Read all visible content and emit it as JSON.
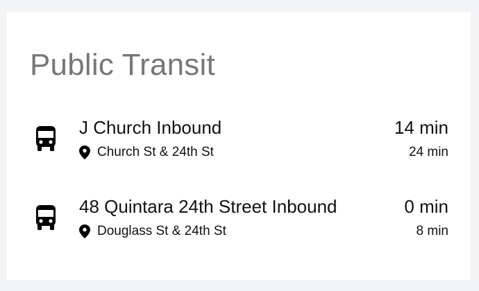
{
  "card": {
    "title": "Public Transit"
  },
  "departures": [
    {
      "icon": "bus-icon",
      "line": "J Church Inbound",
      "stop_icon": "map-pin-icon",
      "stop": "Church St & 24th St",
      "eta": "14 min",
      "next": "24 min"
    },
    {
      "icon": "bus-icon",
      "line": "48 Quintara 24th Street Inbound",
      "stop_icon": "map-pin-icon",
      "stop": "Douglass St & 24th St",
      "eta": "0 min",
      "next": "8 min"
    }
  ]
}
